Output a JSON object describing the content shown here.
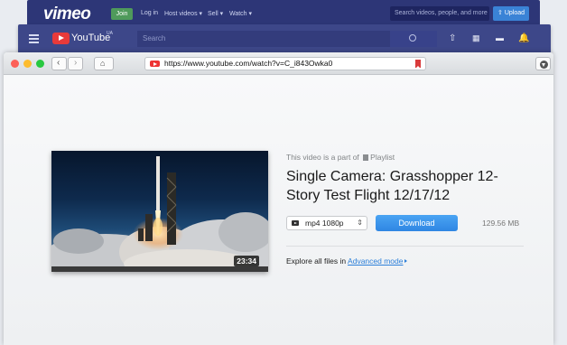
{
  "vimeo": {
    "logo": "vimeo",
    "join": "Join",
    "links": [
      "Log in",
      "Host videos ▾",
      "Sell ▾",
      "Watch ▾"
    ],
    "search_placeholder": "Search videos, people, and more",
    "upload": "Upload"
  },
  "youtube": {
    "logo": "YouTube",
    "region": "UA",
    "search_placeholder": "Search"
  },
  "browser": {
    "url": "https://www.youtube.com/watch?v=C_i843Owka0"
  },
  "video": {
    "duration": "23:34",
    "playlist_prefix": "This video is a part of",
    "playlist_label": "Playlist",
    "title": "Single Camera: Grasshopper 12-Story Test Flight 12/17/12",
    "format": "mp4 1080p",
    "download_label": "Download",
    "file_size": "129.56 MB",
    "explore_prefix": "Explore all files in",
    "advanced_mode": "Advanced mode"
  },
  "colors": {
    "download_button": "#2f86e3",
    "link": "#2c7fd9",
    "vimeo_bg": "#2d3677",
    "youtube_bg": "#3d4789"
  }
}
